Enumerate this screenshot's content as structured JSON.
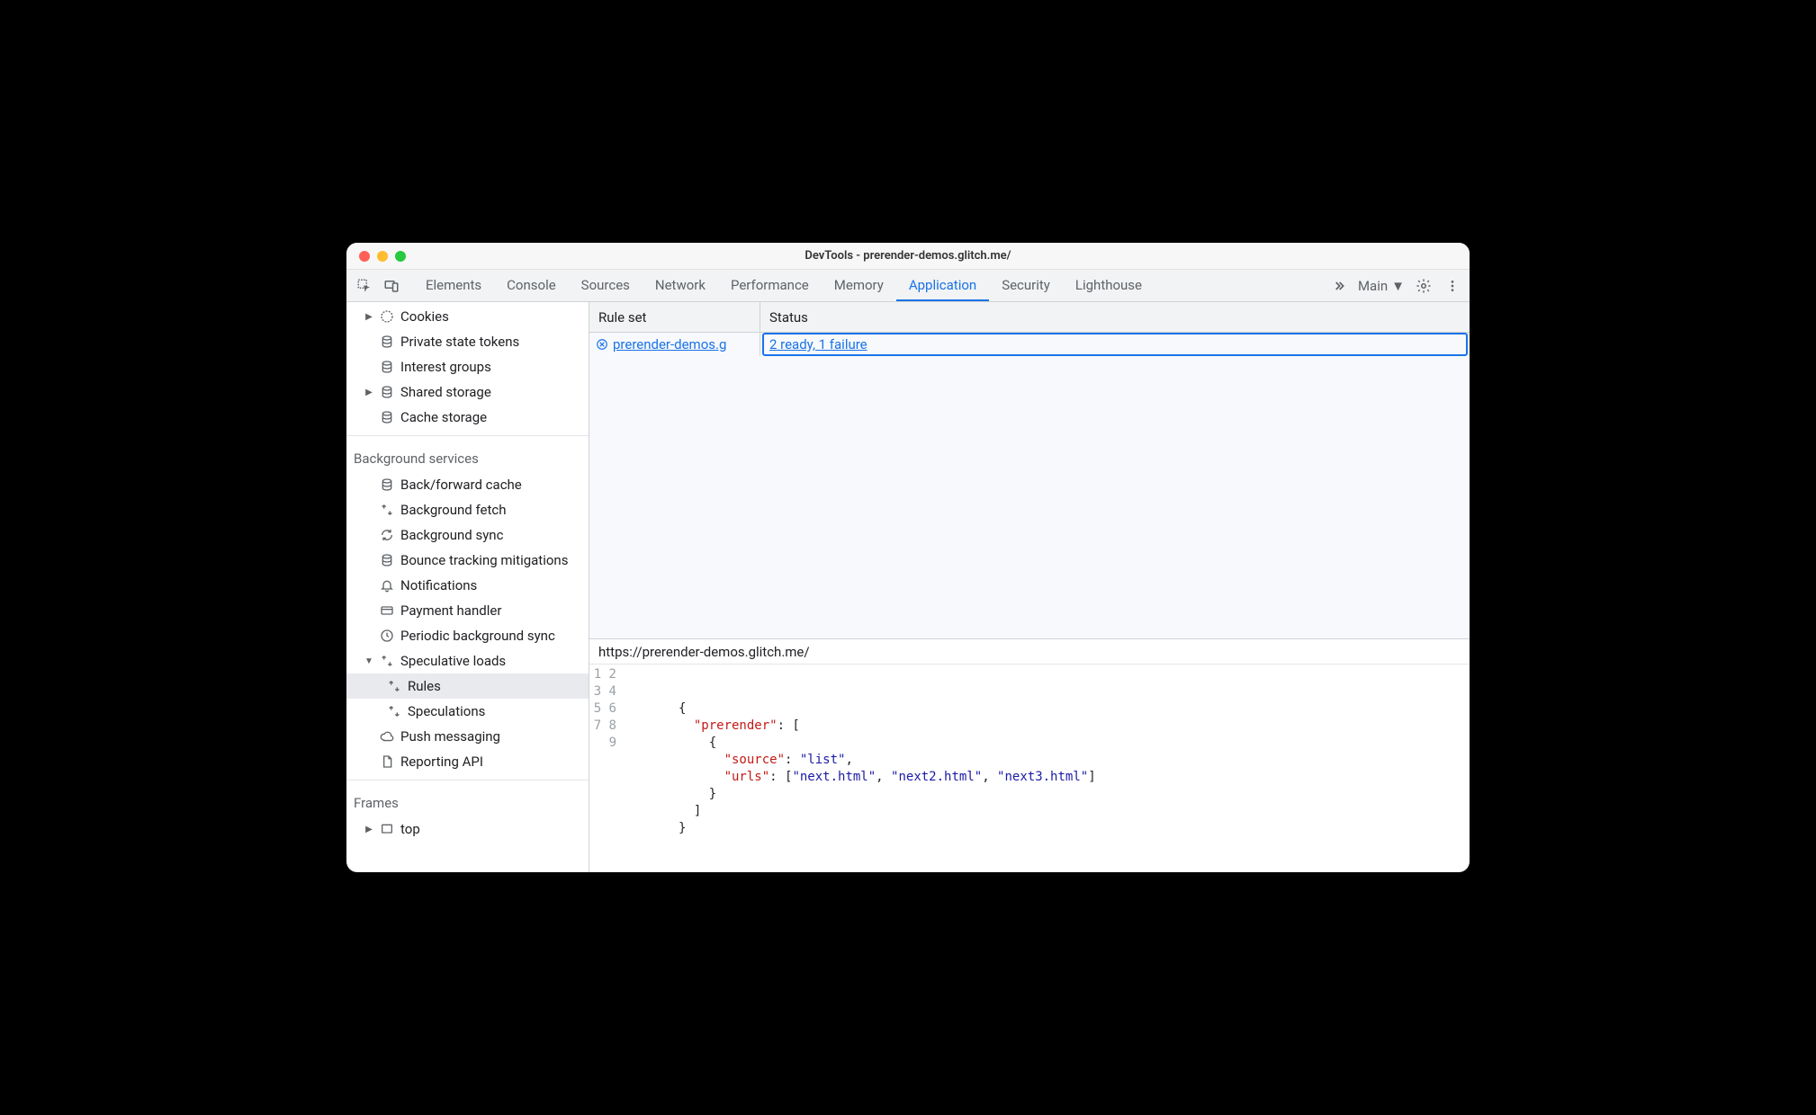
{
  "titlebar": {
    "title": "DevTools - prerender-demos.glitch.me/"
  },
  "toolbar": {
    "tabs": [
      {
        "label": "Elements"
      },
      {
        "label": "Console"
      },
      {
        "label": "Sources"
      },
      {
        "label": "Network"
      },
      {
        "label": "Performance"
      },
      {
        "label": "Memory"
      },
      {
        "label": "Application",
        "active": true
      },
      {
        "label": "Security"
      },
      {
        "label": "Lighthouse"
      }
    ],
    "frame_selector": "Main"
  },
  "sidebar": {
    "storage_items": [
      {
        "label": "Cookies",
        "icon": "cookie",
        "expandable": true
      },
      {
        "label": "Private state tokens",
        "icon": "db"
      },
      {
        "label": "Interest groups",
        "icon": "db"
      },
      {
        "label": "Shared storage",
        "icon": "db",
        "expandable": true
      },
      {
        "label": "Cache storage",
        "icon": "db"
      }
    ],
    "bg_heading": "Background services",
    "bg_items": [
      {
        "label": "Back/forward cache",
        "icon": "db"
      },
      {
        "label": "Background fetch",
        "icon": "sync"
      },
      {
        "label": "Background sync",
        "icon": "refresh"
      },
      {
        "label": "Bounce tracking mitigations",
        "icon": "db"
      },
      {
        "label": "Notifications",
        "icon": "bell"
      },
      {
        "label": "Payment handler",
        "icon": "card"
      },
      {
        "label": "Periodic background sync",
        "icon": "clock"
      },
      {
        "label": "Speculative loads",
        "icon": "sync",
        "expanded": true,
        "children": [
          {
            "label": "Rules",
            "icon": "sync",
            "selected": true
          },
          {
            "label": "Speculations",
            "icon": "sync"
          }
        ]
      },
      {
        "label": "Push messaging",
        "icon": "cloud"
      },
      {
        "label": "Reporting API",
        "icon": "doc"
      }
    ],
    "frames_heading": "Frames",
    "frames_items": [
      {
        "label": "top",
        "icon": "frame",
        "expandable": true
      }
    ]
  },
  "ruleset": {
    "col1": "Rule set",
    "col2": "Status",
    "rows": [
      {
        "link": "prerender-demos.g",
        "status": "2 ready, 1 failure",
        "error": true
      }
    ]
  },
  "url": "https://prerender-demos.glitch.me/",
  "code": {
    "lines": [
      1,
      2,
      3,
      4,
      5,
      6,
      7,
      8,
      9
    ],
    "json": {
      "prerender": [
        {
          "source": "list",
          "urls": [
            "next.html",
            "next2.html",
            "next3.html"
          ]
        }
      ]
    },
    "l2_open": "{",
    "l3_key": "\"prerender\"",
    "l3_colon": ": [",
    "l4_open": "{",
    "l5_key": "\"source\"",
    "l5_val": "\"list\"",
    "l6_key": "\"urls\"",
    "l6_v1": "\"next.html\"",
    "l6_v2": "\"next2.html\"",
    "l6_v3": "\"next3.html\"",
    "l7_close": "}",
    "l8_close": "]",
    "l9_close": "}"
  }
}
